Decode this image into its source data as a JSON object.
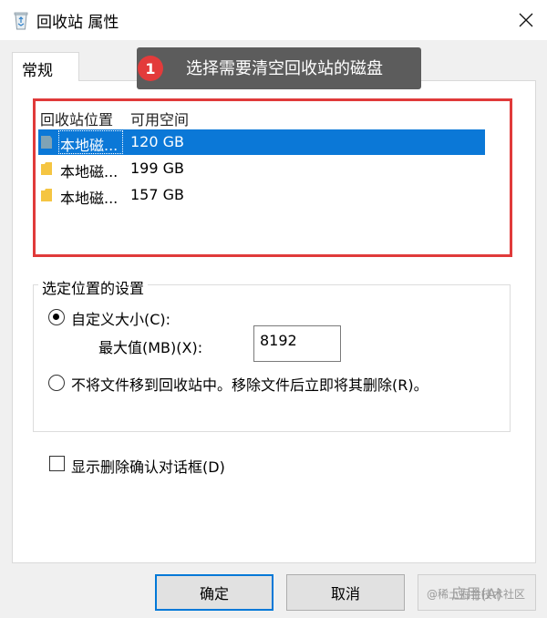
{
  "window": {
    "title": "回收站 属性",
    "icon": "recycle-bin-icon",
    "close_icon": "close-icon"
  },
  "tabs": [
    {
      "label": "常规",
      "selected": true
    }
  ],
  "callout": {
    "badge": "1",
    "text": "选择需要清空回收站的磁盘",
    "highlight_color": "#e03a3a"
  },
  "list": {
    "headers": {
      "location": "回收站位置",
      "space": "可用空间"
    },
    "rows": [
      {
        "name": "本地磁...",
        "space": "120 GB",
        "selected": true
      },
      {
        "name": "本地磁...",
        "space": "199 GB",
        "selected": false
      },
      {
        "name": "本地磁...",
        "space": "157 GB",
        "selected": false
      }
    ],
    "selection_color": "#0b78d7"
  },
  "settings": {
    "group_label": "选定位置的设置",
    "custom_size_label": "自定义大小(C):",
    "max_value_label": "最大值(MB)(X):",
    "max_value": "8192",
    "no_move_label": "不将文件移到回收站中。移除文件后立即将其删除(R)。",
    "selected_option": "custom_size"
  },
  "confirm": {
    "label": "显示删除确认对话框(D)",
    "checked": false
  },
  "buttons": {
    "ok": "确定",
    "cancel": "取消",
    "apply": "应用(A)"
  },
  "watermark": "@稀土掘金技术社区"
}
